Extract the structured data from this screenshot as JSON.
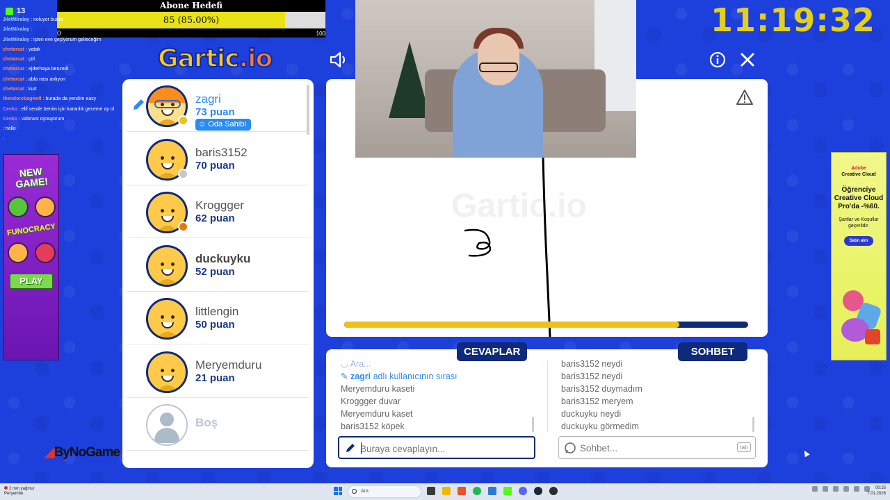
{
  "stream": {
    "kick_viewers": "13",
    "sub_goal_title": "Abone Hedefi",
    "sub_goal_text": "85 (85.00%)",
    "sub_goal_progress": 0.85,
    "sub_goal_min": "0",
    "sub_goal_max": "100",
    "clock": "11:19:32",
    "chat": [
      {
        "name": "JiletMiralay",
        "text": ": noluyor burda",
        "color": "b"
      },
      {
        "name": "JiletMiralay",
        "text": ":",
        "color": "b"
      },
      {
        "name": "JiletMiralay",
        "text": ": işten eve geçiyorum gelieceğim",
        "color": "b"
      },
      {
        "name": "chetarcat",
        "text": ": yatak",
        "color": "o"
      },
      {
        "name": "chetarcat",
        "text": ": çöl",
        "color": "o"
      },
      {
        "name": "chetarcat",
        "text": ": ejderhaya benzedi",
        "color": "o"
      },
      {
        "name": "chetarcat",
        "text": ": abla nası anlıyon",
        "color": "o"
      },
      {
        "name": "chetarcat",
        "text": ": kurt",
        "color": "o"
      },
      {
        "name": "theodorebagwell",
        "text": ": burada da yendim easy",
        "color": "o"
      },
      {
        "name": "Ceeko",
        "text": ": elif sende benim için karanlık geceme ay ol",
        "color": "p"
      },
      {
        "name": "Ceeko",
        "text": ": valorant oynuyorum",
        "color": "p"
      },
      {
        "name": "",
        "text": ": hello",
        "color": "o"
      },
      {
        "name": "",
        "text": ":",
        "color": "o"
      }
    ],
    "left_ad": {
      "line1": "NEW",
      "line2": "GAME!",
      "brand": "FUNOCRACY",
      "cta": "PLAY"
    },
    "right_ad": {
      "brand1": "Adobe",
      "brand2": "Creative Cloud",
      "headline": "Öğrenciye Creative Cloud Pro'da -%60.",
      "terms": "Şartlar ve Koşullar geçerlidir.",
      "cta": "Satın alın"
    },
    "sponsor": "ByNoGame"
  },
  "game": {
    "logo_main": "Gartic",
    "logo_suffix": ".io",
    "watermark": "Gartic.io",
    "timer_progress": 0.83,
    "players": [
      {
        "name": "zagri",
        "points": "73 puan",
        "me": true,
        "owner_badge": "Oda Sahibi",
        "drawing": true
      },
      {
        "name": "baris3152",
        "points": "70 puan",
        "status_color": "#c7c7c7"
      },
      {
        "name": "Kroggger",
        "points": "62 puan",
        "status_color": "#e07a12"
      },
      {
        "name": "duckuyku",
        "points": "52 puan",
        "bold": true
      },
      {
        "name": "littlengin",
        "points": "50 puan"
      },
      {
        "name": "Meryemduru",
        "points": "21 puan"
      },
      {
        "name": "",
        "points": "",
        "empty_label": "Boş"
      }
    ],
    "tabs": {
      "answers": "CEVAPLAR",
      "chat": "SOHBET"
    },
    "answers_feed": [
      {
        "who": "",
        "text": "Ara...",
        "type": "dim"
      },
      {
        "who": "zagri",
        "text": "adlı kullanıcının sırası",
        "type": "turn"
      },
      {
        "who": "Meryemduru",
        "text": "kaseti"
      },
      {
        "who": "Kroggger",
        "text": "duvar"
      },
      {
        "who": "Meryemduru",
        "text": "kaset"
      },
      {
        "who": "baris3152",
        "text": "köpek"
      }
    ],
    "chat_feed": [
      {
        "who": "baris3152",
        "text": "neydi"
      },
      {
        "who": "baris3152",
        "text": "neydi"
      },
      {
        "who": "baris3152",
        "text": "duymadım"
      },
      {
        "who": "baris3152",
        "text": "meryem"
      },
      {
        "who": "duckuyku",
        "text": "neydi"
      },
      {
        "who": "duckuyku",
        "text": "görmedim"
      }
    ],
    "answer_placeholder": "Buraya cevaplayın...",
    "chat_placeholder": "Sohbet...",
    "chat_key_hint": "tab"
  },
  "taskbar": {
    "weather_line1": "2 mm yağmur",
    "weather_line2": "Perşembe",
    "search": "Ara",
    "time": "00:25",
    "date": "7.01.2026"
  }
}
